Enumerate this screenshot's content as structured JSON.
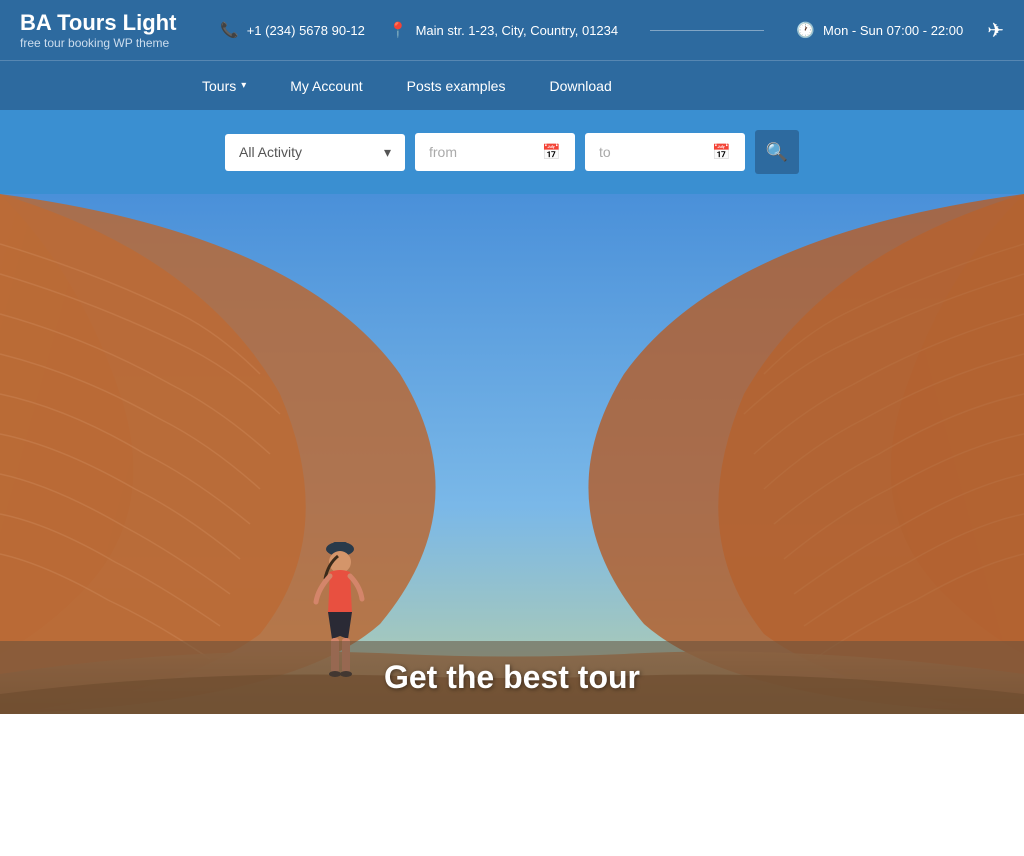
{
  "logo": {
    "title": "BA Tours Light",
    "subtitle": "free tour booking WP theme"
  },
  "contact": {
    "phone": "+1 (234) 5678 90-12",
    "address": "Main str. 1-23, City, Country, 01234",
    "hours": "Mon - Sun 07:00 - 22:00"
  },
  "nav": {
    "items": [
      {
        "label": "Tours",
        "has_dropdown": true
      },
      {
        "label": "My Account",
        "has_dropdown": false
      },
      {
        "label": "Posts examples",
        "has_dropdown": false
      },
      {
        "label": "Download",
        "has_dropdown": false
      }
    ]
  },
  "search": {
    "activity_label": "All Activity",
    "from_placeholder": "from",
    "to_placeholder": "to",
    "chevron": "▾"
  },
  "hero": {
    "tagline": "Get the best tour"
  }
}
